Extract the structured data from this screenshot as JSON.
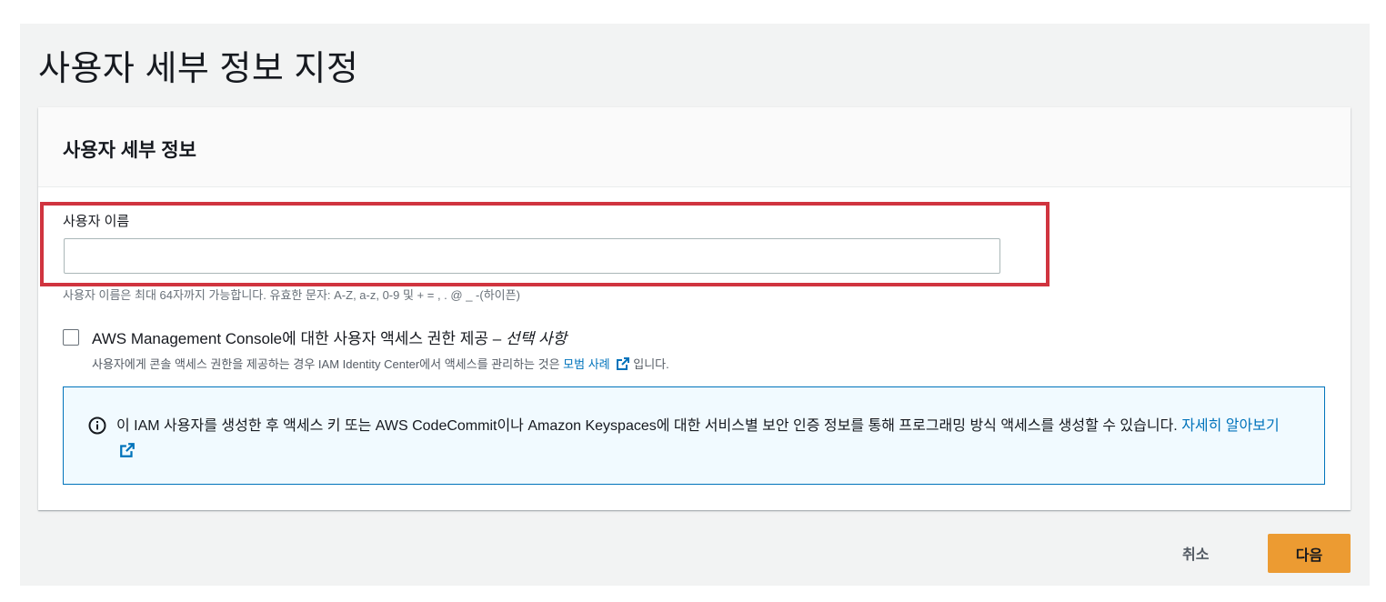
{
  "page": {
    "title": "사용자 세부 정보 지정"
  },
  "panel": {
    "title": "사용자 세부 정보",
    "username": {
      "label": "사용자 이름",
      "value": "",
      "constraint": "사용자 이름은 최대 64자까지 가능합니다. 유효한 문자: A-Z, a-z, 0-9 및 + = , . @ _ -(하이픈)"
    },
    "console_access": {
      "checked": false,
      "label": "AWS Management Console에 대한 사용자 액세스 권한 제공 –",
      "optional": "선택 사항",
      "desc_prefix": "사용자에게 콘솔 액세스 권한을 제공하는 경우 IAM Identity Center에서 액세스를 관리하는 것은",
      "desc_link": "모범 사례",
      "desc_suffix": "입니다."
    },
    "info": {
      "icon": "info-icon",
      "text": "이 IAM 사용자를 생성한 후 액세스 키 또는 AWS CodeCommit이나 Amazon Keyspaces에 대한 서비스별 보안 인증 정보를 통해 프로그래밍 방식 액세스를 생성할 수 있습니다.",
      "link": "자세히 알아보기"
    }
  },
  "footer": {
    "cancel_label": "취소",
    "next_label": "다음"
  },
  "colors": {
    "accent": "#ec9b32",
    "link": "#0073bb",
    "highlight": "#d0343f"
  }
}
